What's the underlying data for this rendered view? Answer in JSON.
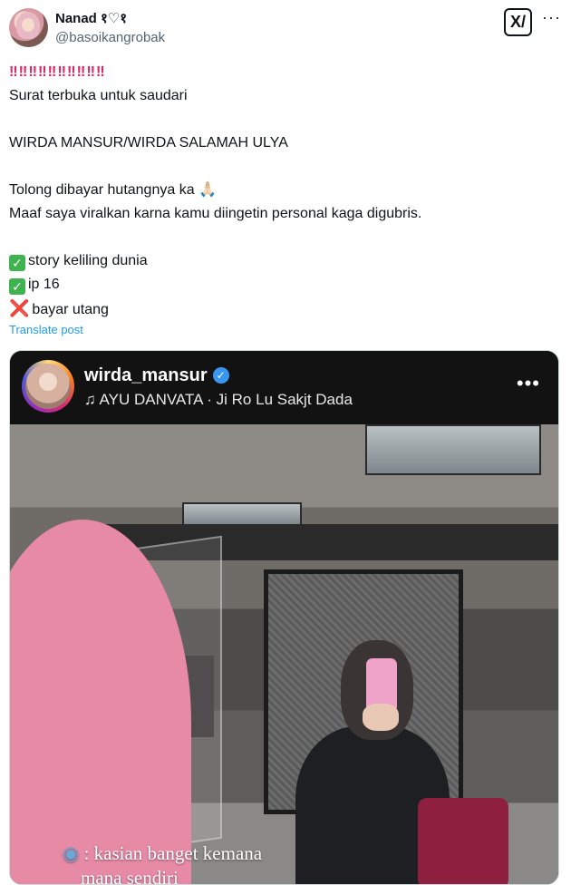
{
  "author": {
    "display_name": "Nanad १♡१",
    "handle": "@basoikangrobak"
  },
  "icons": [
    "grok-icon",
    "more-icon"
  ],
  "post": {
    "line1": "‼‼‼‼‼‼‼‼‼‼",
    "line2": "Surat terbuka untuk saudari",
    "line3": "WIRDA MANSUR/WIRDA SALAMAH ULYA",
    "line4": "Tolong dibayar hutangnya ka 🙏🏻",
    "line5": "Maaf saya viralkan karna kamu diingetin personal kaga digubris.",
    "item1": "story keliling dunia",
    "item2": "ip 16",
    "item3": "bayar utang",
    "translate_label": "Translate post"
  },
  "story": {
    "username": "wirda_mansur",
    "music_artist": "AYU DANVATA",
    "music_song": "Ji Ro Lu Sakjt Dada",
    "caption_line1": ": kasian banget kemana",
    "caption_line2": "mana sendiri"
  },
  "colors": {
    "link": "#1d9bf0",
    "verified": "#3897f0",
    "alarm": "#e0245e",
    "check": "#3fb34f"
  }
}
